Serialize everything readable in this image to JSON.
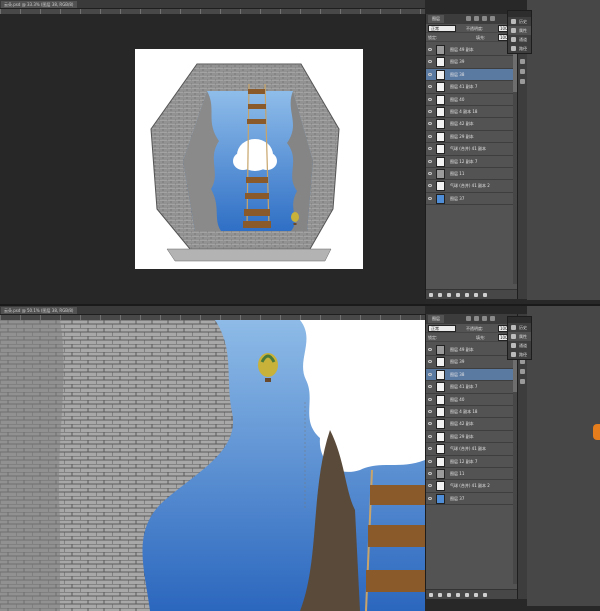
{
  "top": {
    "doc_tab": "云朵.psd @ 33.3% (图层 38, RGB/8)",
    "panel_tab": "图层",
    "blend_mode": "正常",
    "opacity_label": "不透明度:",
    "opacity_value": "100%",
    "lock_label": "锁定:",
    "fill_label": "填充:",
    "fill_value": "100%"
  },
  "bottom": {
    "doc_tab": "云朵.psd @ 50.1% (图层 38, RGB/8)",
    "panel_tab": "图层",
    "blend_mode": "正常",
    "opacity_label": "不透明度:",
    "opacity_value": "100%",
    "lock_label": "锁定:",
    "fill_label": "填充:",
    "fill_value": "100%"
  },
  "layers": [
    {
      "name": "图层 49 副本",
      "thumb": "arch"
    },
    {
      "name": "图层 39",
      "thumb": "white"
    },
    {
      "name": "图层 38",
      "thumb": "white",
      "selected": true
    },
    {
      "name": "图层 41 副本 7",
      "thumb": "white"
    },
    {
      "name": "图层 40",
      "thumb": "white"
    },
    {
      "name": "图层 4 副本 18",
      "thumb": "white"
    },
    {
      "name": "图层 42 副本",
      "thumb": "white"
    },
    {
      "name": "图层 29 副本",
      "thumb": "white"
    },
    {
      "name": "气球 (合并) 41 副本",
      "thumb": "white"
    },
    {
      "name": "图层 12 副本 7",
      "thumb": "white"
    },
    {
      "name": "图层 11",
      "thumb": "arch"
    },
    {
      "name": "气球 (合并) 41 副本 2",
      "thumb": "white"
    },
    {
      "name": "图层 37",
      "thumb": "sky"
    }
  ],
  "side_panel": [
    {
      "label": "历史",
      "icon": "history-icon"
    },
    {
      "label": "属性",
      "icon": "properties-icon"
    },
    {
      "label": "通道",
      "icon": "channels-icon"
    },
    {
      "label": "路径",
      "icon": "paths-icon"
    }
  ],
  "colors": {
    "selected_layer": "#5b7aa2",
    "sky_top": "#7fb0e6",
    "sky_bottom": "#2f6fc5",
    "stone": "#9a9a9a",
    "wood": "#8a5a2b",
    "accent_tab": "#e57d1c"
  }
}
